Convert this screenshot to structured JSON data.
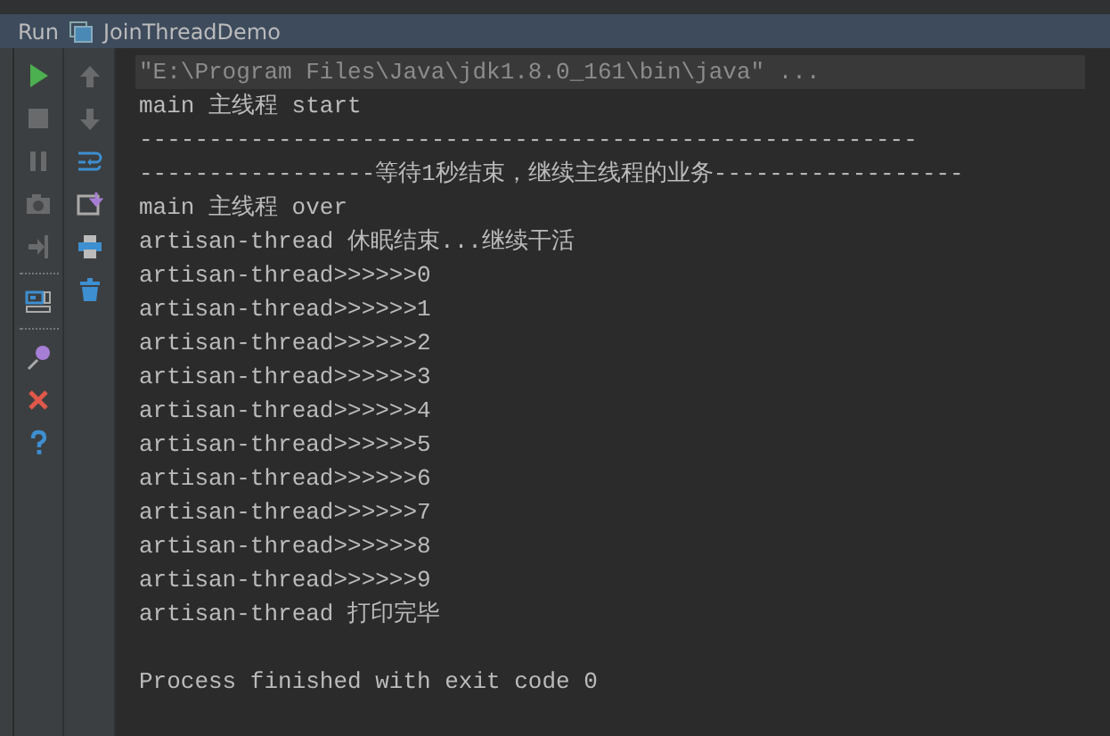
{
  "tab": {
    "label": "Run",
    "title": "JoinThreadDemo"
  },
  "left_toolbar": [
    {
      "kind": "button",
      "disabled": false
    },
    {
      "kind": "button",
      "disabled": true
    },
    {
      "kind": "button",
      "disabled": true
    },
    {
      "kind": "button",
      "disabled": true
    },
    {
      "kind": "button",
      "disabled": true
    },
    {
      "kind": "separator"
    },
    {
      "kind": "button",
      "disabled": false
    },
    {
      "kind": "separator"
    },
    {
      "kind": "button",
      "disabled": false
    },
    {
      "kind": "button",
      "disabled": false
    },
    {
      "kind": "button",
      "disabled": false
    }
  ],
  "right_toolbar": [
    {
      "kind": "button",
      "disabled": true
    },
    {
      "kind": "button",
      "disabled": true
    },
    {
      "kind": "button",
      "disabled": false
    },
    {
      "kind": "button",
      "disabled": false
    },
    {
      "kind": "button",
      "disabled": false
    },
    {
      "kind": "button",
      "disabled": false
    }
  ],
  "console": [
    {
      "kind": "command",
      "text": "\"E:\\Program Files\\Java\\jdk1.8.0_161\\bin\\java\" ..."
    },
    {
      "kind": "output",
      "text": "main 主线程 start"
    },
    {
      "kind": "output",
      "text": "--------------------------------------------------------"
    },
    {
      "kind": "output",
      "text": "-----------------等待1秒结束，继续主线程的业务------------------"
    },
    {
      "kind": "output",
      "text": "main 主线程 over"
    },
    {
      "kind": "output",
      "text": "artisan-thread 休眠结束...继续干活"
    },
    {
      "kind": "output",
      "text": "artisan-thread>>>>>>0"
    },
    {
      "kind": "output",
      "text": "artisan-thread>>>>>>1"
    },
    {
      "kind": "output",
      "text": "artisan-thread>>>>>>2"
    },
    {
      "kind": "output",
      "text": "artisan-thread>>>>>>3"
    },
    {
      "kind": "output",
      "text": "artisan-thread>>>>>>4"
    },
    {
      "kind": "output",
      "text": "artisan-thread>>>>>>5"
    },
    {
      "kind": "output",
      "text": "artisan-thread>>>>>>6"
    },
    {
      "kind": "output",
      "text": "artisan-thread>>>>>>7"
    },
    {
      "kind": "output",
      "text": "artisan-thread>>>>>>8"
    },
    {
      "kind": "output",
      "text": "artisan-thread>>>>>>9"
    },
    {
      "kind": "output",
      "text": "artisan-thread 打印完毕"
    },
    {
      "kind": "blank"
    },
    {
      "kind": "output",
      "text": "Process finished with exit code 0"
    }
  ]
}
